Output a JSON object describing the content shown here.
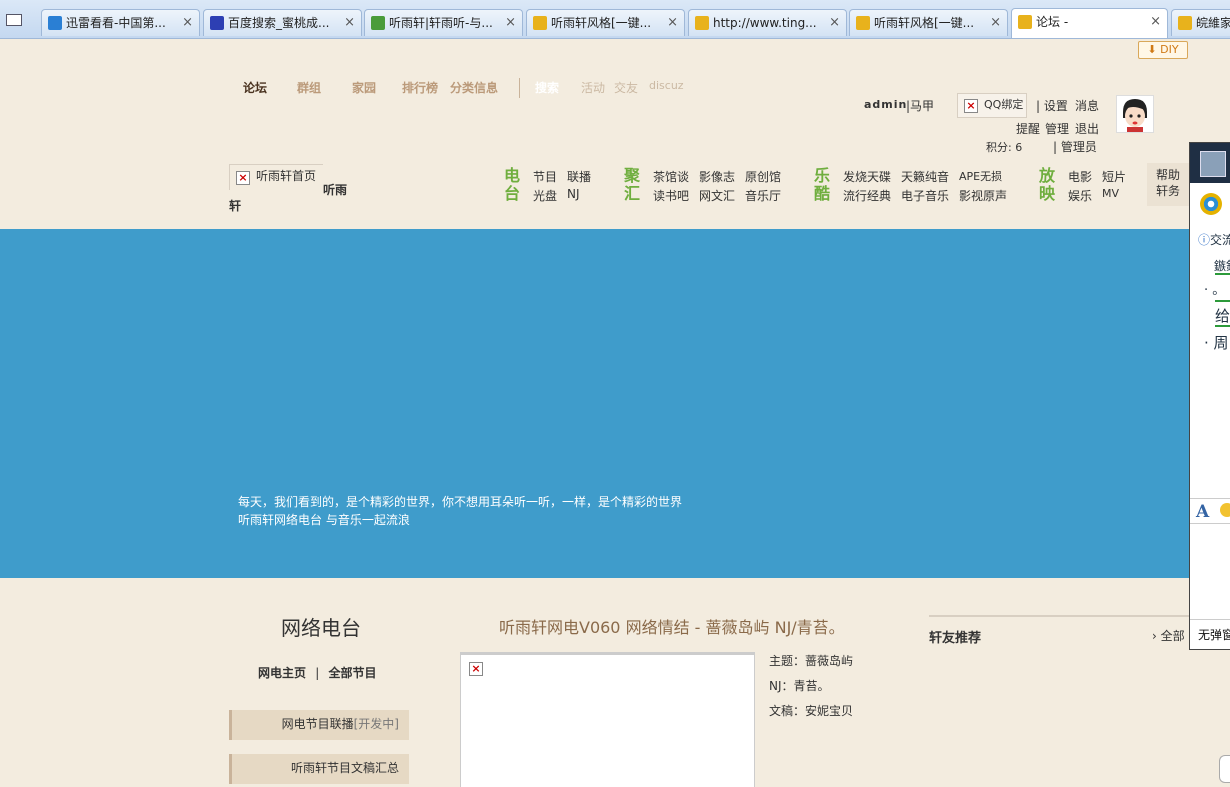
{
  "browser": {
    "tabs": [
      {
        "title": "迅雷看看-中国第...",
        "active": false,
        "icon": "xunlei-icon",
        "color": "#2a7fd4"
      },
      {
        "title": "百度搜索_蜜桃成...",
        "active": false,
        "icon": "baidu-paw-icon",
        "color": "#2d3fb3"
      },
      {
        "title": "听雨轩|轩雨听-与...",
        "active": false,
        "icon": "refresh-page-icon",
        "color": "#4a9c3a"
      },
      {
        "title": "听雨轩风格[一键...",
        "active": false,
        "icon": "discuz-cat-icon",
        "color": "#e8b21c"
      },
      {
        "title": "http://www.ting...",
        "active": false,
        "icon": "discuz-cat-icon",
        "color": "#e8b21c"
      },
      {
        "title": "听雨轩风格[一键...",
        "active": false,
        "icon": "discuz-cat-icon",
        "color": "#e8b21c"
      },
      {
        "title": "论坛 -",
        "active": true,
        "icon": "discuz-cat-icon",
        "color": "#e8b21c"
      },
      {
        "title": "皖維家",
        "active": false,
        "icon": "discuz-cat-icon",
        "color": "#e8b21c"
      }
    ]
  },
  "header": {
    "diy_label": "DIY",
    "nav": [
      "论坛",
      "群组",
      "家园",
      "排行榜",
      "分类信息",
      "搜索",
      "活动",
      "交友",
      "discuz"
    ],
    "user": {
      "name": "admin",
      "nickname": "马甲",
      "qq_bind": "QQ绑定",
      "settings": "设置",
      "messages": "消息",
      "reminders": "提醒",
      "manage": "管理",
      "logout": "退出",
      "points_label": "积分: 6",
      "role": "管理员"
    },
    "home_link": "听雨轩首页",
    "site_name_a": "听雨",
    "site_name_b": "轩"
  },
  "categories": [
    {
      "title": "电台",
      "items": [
        "节目",
        "联播",
        "光盘",
        "NJ"
      ]
    },
    {
      "title": "聚汇",
      "items": [
        "茶馆谈",
        "影像志",
        "原创馆",
        "读书吧",
        "网文汇",
        "音乐厅"
      ]
    },
    {
      "title": "乐酷",
      "items": [
        "发烧天碟",
        "天籁纯音",
        "APE无损",
        "流行经典",
        "电子音乐",
        "影视原声"
      ]
    },
    {
      "title": "放映",
      "items": [
        "电影",
        "短片",
        "娱乐",
        "MV"
      ]
    }
  ],
  "help_box": [
    "帮助",
    "轩务"
  ],
  "banner": {
    "line1": "每天，我们看到的，是个精彩的世界，你不想用耳朵听一听，一样，是个精彩的世界",
    "line2": "听雨轩网络电台 与音乐一起流浪"
  },
  "radio": {
    "title": "网络电台",
    "link_home": "网电主页",
    "link_all": "全部节目",
    "btn_relay": "网电节目联播",
    "btn_relay_tag": "[开发中]",
    "btn_scripts": "听雨轩节目文稿汇总"
  },
  "track": {
    "title": "听雨轩网电V060 网络情结 - 蔷薇岛屿 NJ/青苔。",
    "theme": "主题：蔷薇岛屿",
    "nj": "NJ：青苔。",
    "writer": "文稿：安妮宝贝"
  },
  "friends": {
    "title": "轩友推荐",
    "all": "全部"
  },
  "chat": {
    "label": "交流",
    "lines": [
      "鏃鎖",
      "。",
      "给",
      "周"
    ],
    "no_popup": "无弹窗"
  }
}
